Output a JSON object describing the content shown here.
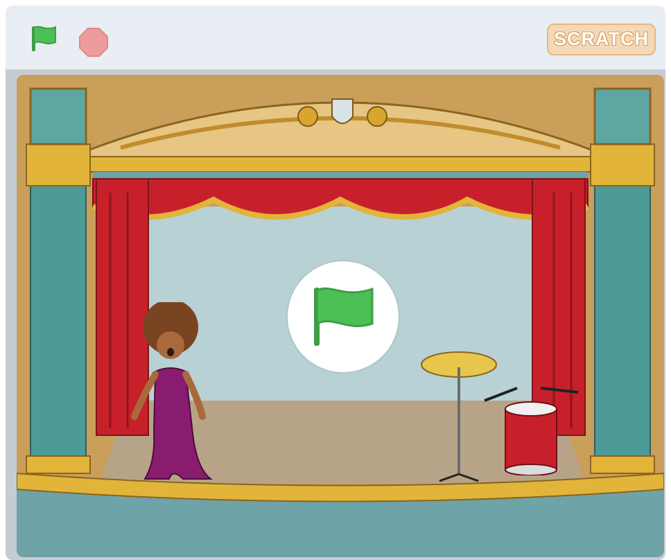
{
  "toolbar": {
    "green_flag": {
      "icon": "green-flag-icon",
      "color": "#4cbf56"
    },
    "stop": {
      "icon": "stop-sign-icon",
      "color": "#ec9c9c"
    },
    "logo_text": "SCRATCH"
  },
  "stage": {
    "backdrop": "theater-stage",
    "sprites": [
      "singer",
      "cymbal",
      "drum"
    ],
    "play_overlay": {
      "icon": "green-flag-icon",
      "color": "#4cbf56"
    }
  },
  "colors": {
    "toolbar_bg": "#e9eef4",
    "frame": "#c7ccd4",
    "curtain": "#c8202a",
    "gold": "#e3b43a",
    "teal": "#4e9a96",
    "floor": "#b7a488"
  }
}
